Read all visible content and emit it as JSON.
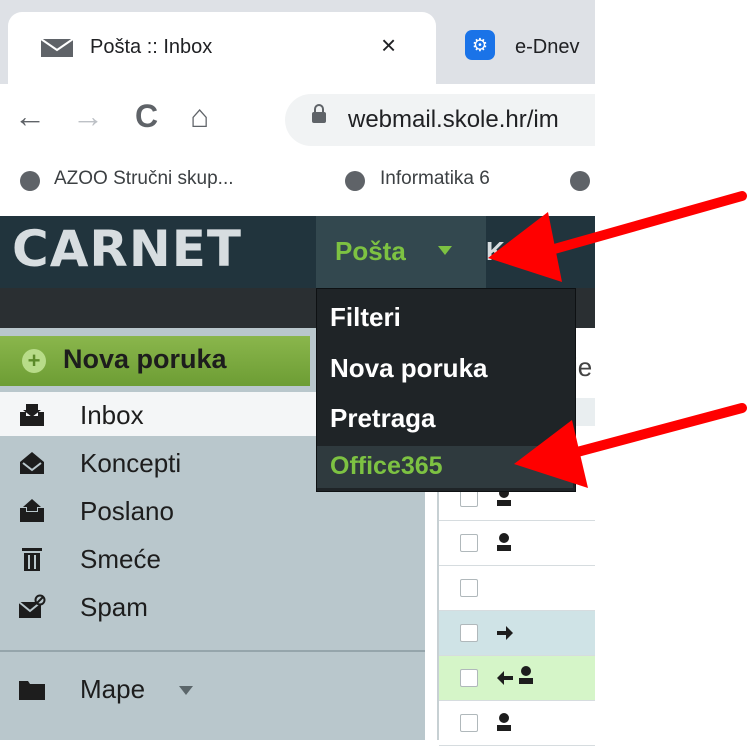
{
  "browser": {
    "active_tab_title": "Pošta :: Inbox",
    "tab_close": "×",
    "second_tab_title": "e-Dnev",
    "nav": {
      "back": "←",
      "forward": "→",
      "reload": "C",
      "home": "⌂"
    },
    "url": "webmail.skole.hr/im",
    "bookmarks": [
      "AZOO Stručni skup...",
      "Informatika 6"
    ]
  },
  "app": {
    "logo": "CARNET",
    "nav_active": "Pošta",
    "nav_next": "Kalen",
    "main_header_partial": "je"
  },
  "dropdown": {
    "items": [
      "Filteri",
      "Nova poruka",
      "Pretraga",
      "Office365"
    ]
  },
  "sidebar": {
    "new_message": "Nova poruka",
    "folders": [
      {
        "label": "Inbox",
        "icon": "inbox-icon"
      },
      {
        "label": "Koncepti",
        "icon": "drafts-icon"
      },
      {
        "label": "Poslano",
        "icon": "sent-icon"
      },
      {
        "label": "Smeće",
        "icon": "trash-icon"
      },
      {
        "label": "Spam",
        "icon": "spam-icon"
      }
    ],
    "mape": "Mape"
  },
  "message_rows": [
    {
      "icon": "person-icon",
      "highlight": "none"
    },
    {
      "icon": "person-icon",
      "highlight": "none"
    },
    {
      "icon": "none",
      "highlight": "none"
    },
    {
      "icon": "forward-arrow-icon",
      "highlight": "#cfe3e6"
    },
    {
      "icon": "reply-person-icon",
      "highlight": "#d5f5c8"
    },
    {
      "icon": "person-icon",
      "highlight": "none"
    }
  ],
  "colors": {
    "accent_green": "#7dc242",
    "annotation_arrow": "#ff0000",
    "header_bg": "#21343d"
  }
}
